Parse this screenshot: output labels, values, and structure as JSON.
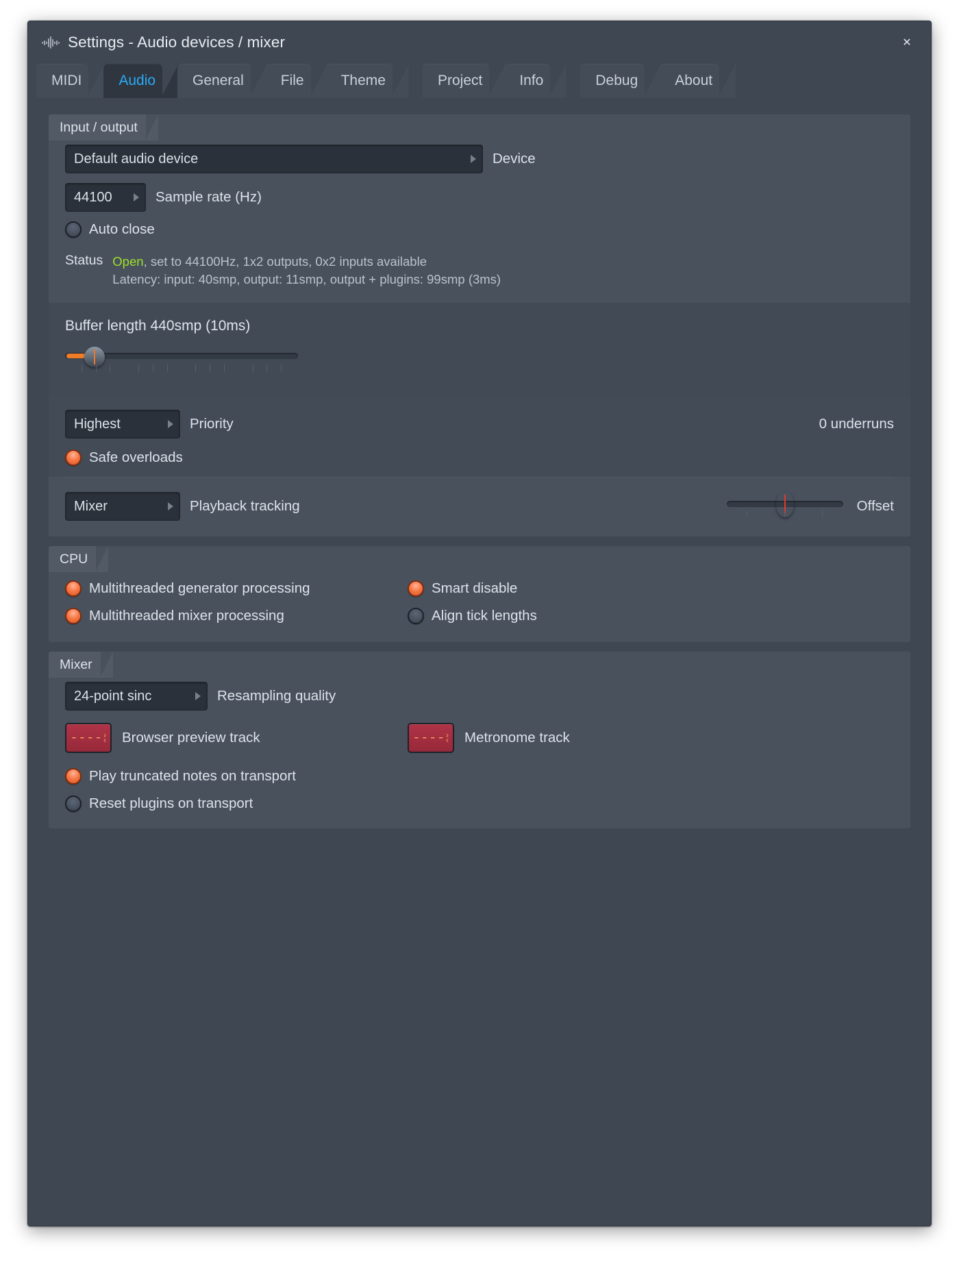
{
  "window": {
    "title": "Settings - Audio devices / mixer",
    "icon": "waveform-icon",
    "close_label": "✕"
  },
  "tabs": [
    {
      "label": "MIDI",
      "active": false
    },
    {
      "label": "Audio",
      "active": true
    },
    {
      "label": "General",
      "active": false
    },
    {
      "label": "File",
      "active": false
    },
    {
      "label": "Theme",
      "active": false
    },
    {
      "label": "Project",
      "active": false
    },
    {
      "label": "Info",
      "active": false
    },
    {
      "label": "Debug",
      "active": false
    },
    {
      "label": "About",
      "active": false
    }
  ],
  "input_output": {
    "group_title": "Input / output",
    "device": {
      "value": "Default audio device",
      "label": "Device"
    },
    "sample_rate": {
      "value": "44100",
      "label": "Sample rate (Hz)"
    },
    "auto_close": {
      "label": "Auto close",
      "checked": false
    },
    "status": {
      "key": "Status",
      "state": "Open",
      "line1_rest": ", set to 44100Hz, 1x2 outputs, 0x2 inputs available",
      "line2": "Latency: input: 40smp, output: 11smp, output + plugins: 99smp (3ms)"
    },
    "buffer": {
      "title": "Buffer length 440smp (10ms)"
    },
    "priority": {
      "value": "Highest",
      "label": "Priority",
      "underruns": "0 underruns"
    },
    "safe_overloads": {
      "label": "Safe overloads",
      "checked": true
    },
    "playback_tracking": {
      "value": "Mixer",
      "label": "Playback tracking",
      "offset_label": "Offset"
    }
  },
  "cpu": {
    "group_title": "CPU",
    "options": [
      {
        "label": "Multithreaded generator processing",
        "checked": true
      },
      {
        "label": "Multithreaded mixer processing",
        "checked": true
      },
      {
        "label": "Smart disable",
        "checked": true
      },
      {
        "label": "Align tick lengths",
        "checked": false
      }
    ]
  },
  "mixer": {
    "group_title": "Mixer",
    "resampling": {
      "value": "24-point sinc",
      "label": "Resampling quality"
    },
    "browser_preview": {
      "value": "----",
      "label": "Browser preview track"
    },
    "metronome": {
      "value": "----",
      "label": "Metronome track"
    },
    "options": [
      {
        "label": "Play truncated notes on transport",
        "checked": true
      },
      {
        "label": "Reset plugins on transport",
        "checked": false
      }
    ]
  },
  "colors": {
    "accent_blue": "#2aaaf5",
    "accent_orange": "#ef7d27",
    "status_green": "#9ee02a",
    "track_red": "#a82e40",
    "window_bg": "#3f4753",
    "group_bg": "#49515d"
  }
}
